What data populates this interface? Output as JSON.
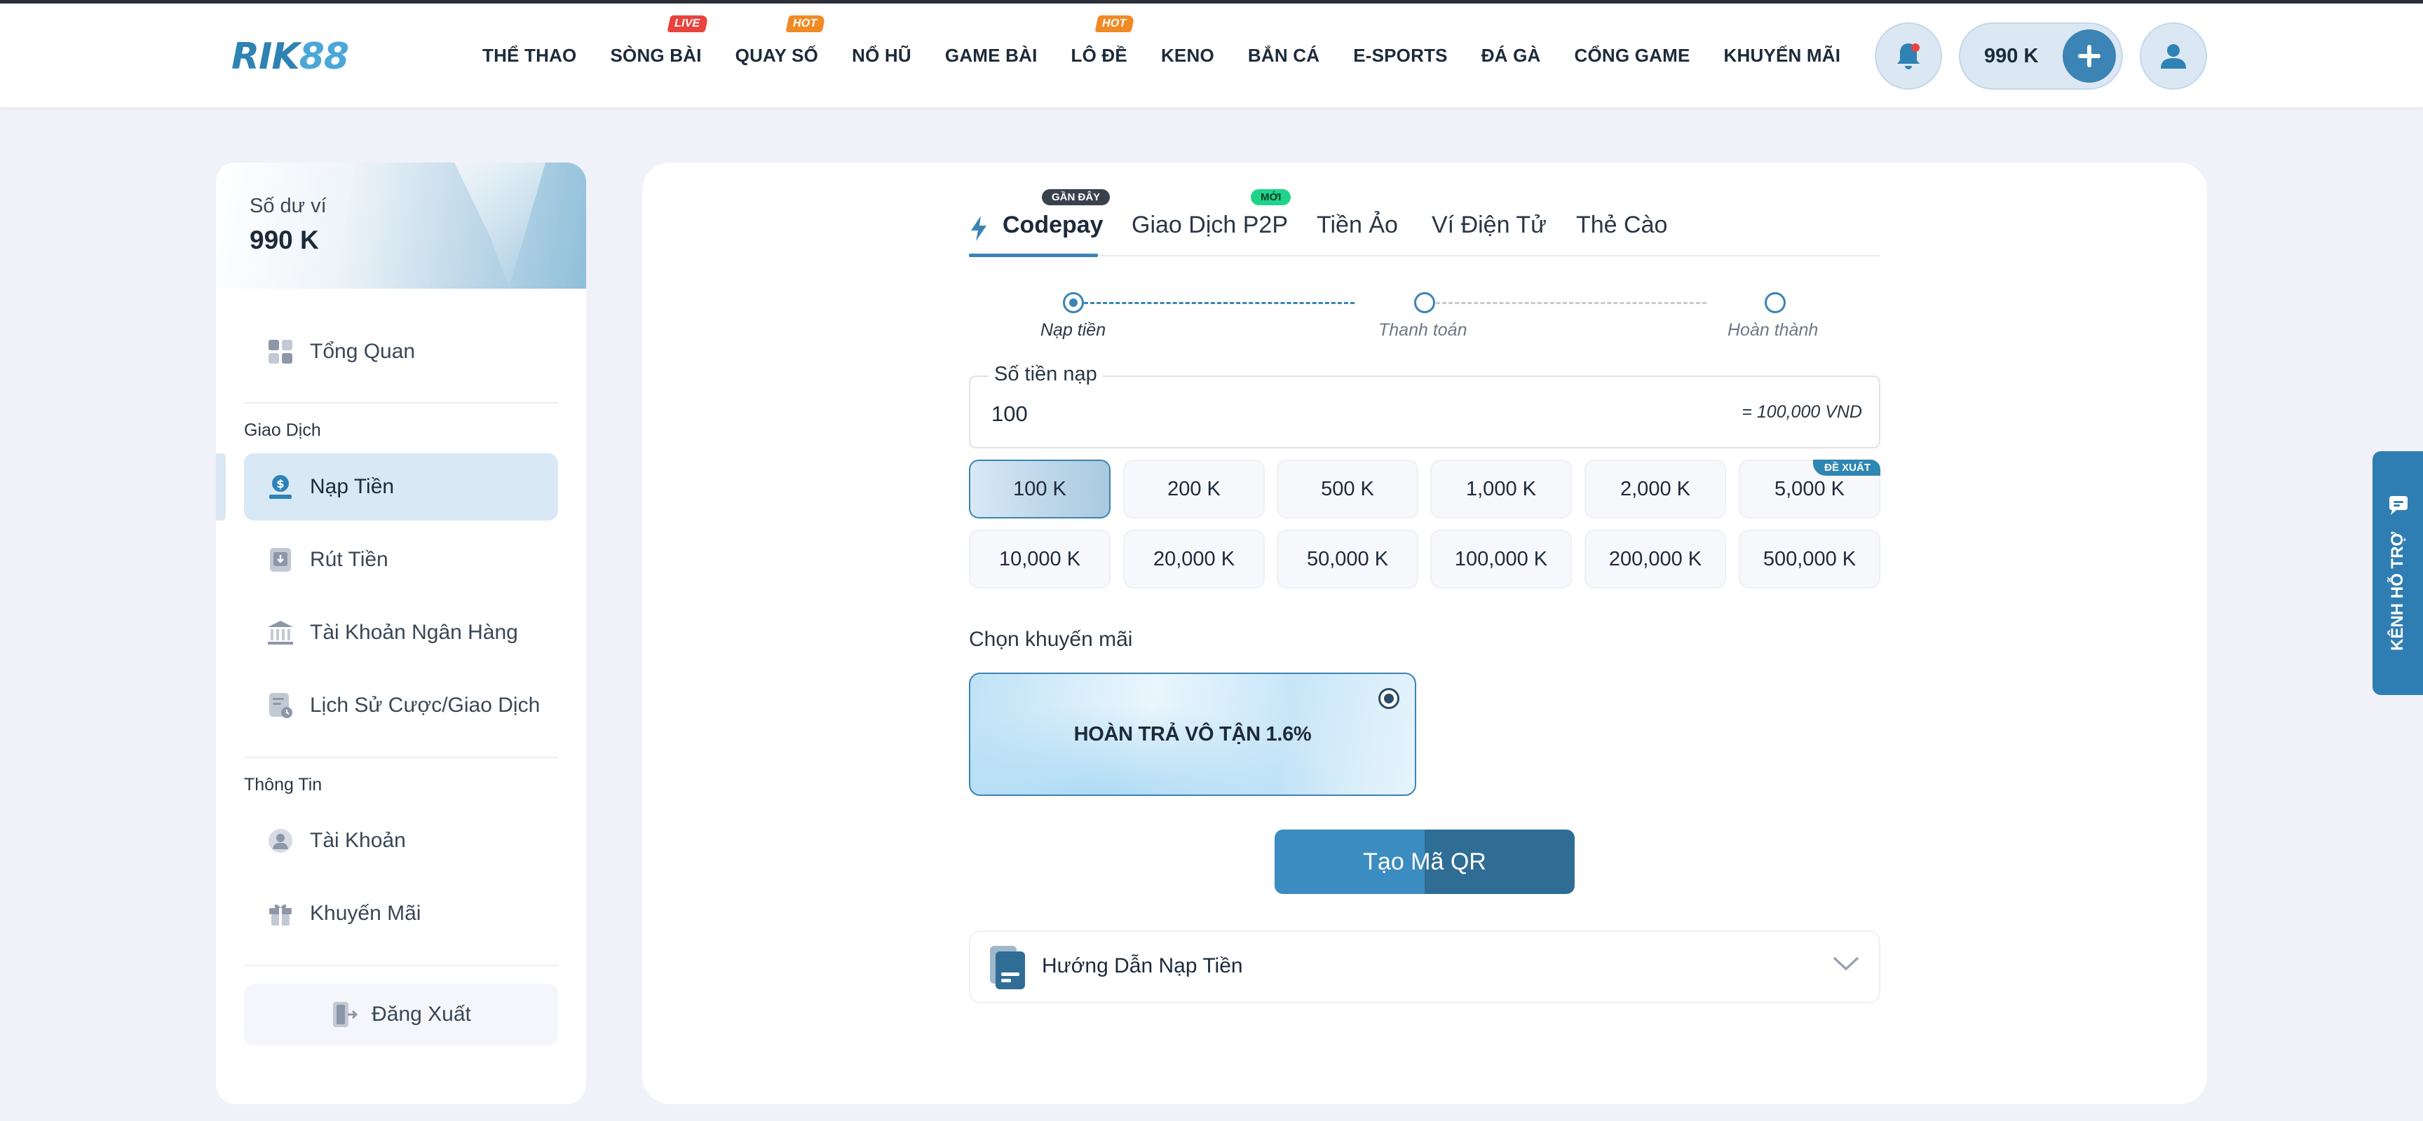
{
  "brand": {
    "logo_part1": "RIK",
    "logo_part2": "88"
  },
  "nav": [
    {
      "label": "THỂ THAO",
      "badge": null
    },
    {
      "label": "SÒNG BÀI",
      "badge": "LIVE"
    },
    {
      "label": "QUAY SỐ",
      "badge": "HOT"
    },
    {
      "label": "NỔ HŨ",
      "badge": null
    },
    {
      "label": "GAME BÀI",
      "badge": null
    },
    {
      "label": "LÔ ĐỀ",
      "badge": "HOT"
    },
    {
      "label": "KENO",
      "badge": null
    },
    {
      "label": "BẮN CÁ",
      "badge": null
    },
    {
      "label": "E-SPORTS",
      "badge": null
    },
    {
      "label": "ĐÁ GÀ",
      "badge": null
    },
    {
      "label": "CỔNG GAME",
      "badge": null
    },
    {
      "label": "KHUYẾN MÃI",
      "badge": null
    }
  ],
  "header": {
    "balance": "990 K",
    "bell_icon": "bell-icon",
    "user_icon": "user-icon",
    "plus_icon": "plus-icon"
  },
  "wallet": {
    "label": "Số dư ví",
    "value": "990 K"
  },
  "sidebar": {
    "overview": "Tổng Quan",
    "section_transactions": "Giao Dịch",
    "deposit": "Nạp Tiền",
    "withdraw": "Rút Tiền",
    "bank_account": "Tài Khoản Ngân Hàng",
    "history": "Lịch Sử Cược/Giao Dịch",
    "section_info": "Thông Tin",
    "account": "Tài Khoản",
    "promotions": "Khuyến Mãi",
    "logout": "Đăng Xuất"
  },
  "tabs": [
    {
      "label": "Codepay",
      "badge": "GẦN ĐÂY",
      "active": true
    },
    {
      "label": "Giao Dịch P2P",
      "badge": "MỚI",
      "active": false
    },
    {
      "label": "Tiền Ảo",
      "badge": null,
      "active": false
    },
    {
      "label": "Ví Điện Tử",
      "badge": null,
      "active": false
    },
    {
      "label": "Thẻ Cào",
      "badge": null,
      "active": false
    }
  ],
  "steps": [
    {
      "label": "Nạp tiền",
      "active": true
    },
    {
      "label": "Thanh toán",
      "active": false
    },
    {
      "label": "Hoàn thành",
      "active": false
    }
  ],
  "amount": {
    "label": "Số tiền nạp",
    "value": "100",
    "converted": "= 100,000 VND"
  },
  "amount_options": [
    {
      "label": "100 K",
      "selected": true,
      "badge": null
    },
    {
      "label": "200 K",
      "selected": false,
      "badge": null
    },
    {
      "label": "500 K",
      "selected": false,
      "badge": null
    },
    {
      "label": "1,000 K",
      "selected": false,
      "badge": null
    },
    {
      "label": "2,000 K",
      "selected": false,
      "badge": null
    },
    {
      "label": "5,000 K",
      "selected": false,
      "badge": "ĐỀ XUẤT"
    },
    {
      "label": "10,000 K",
      "selected": false,
      "badge": null
    },
    {
      "label": "20,000 K",
      "selected": false,
      "badge": null
    },
    {
      "label": "50,000 K",
      "selected": false,
      "badge": null
    },
    {
      "label": "100,000 K",
      "selected": false,
      "badge": null
    },
    {
      "label": "200,000 K",
      "selected": false,
      "badge": null
    },
    {
      "label": "500,000 K",
      "selected": false,
      "badge": null
    }
  ],
  "promo": {
    "label": "Chọn khuyến mãi",
    "option": "HOÀN TRẢ VÔ TẬN 1.6%",
    "selected": true
  },
  "submit": {
    "label": "Tạo Mã QR"
  },
  "guide": {
    "label": "Hướng Dẫn Nạp Tiền"
  },
  "support": {
    "label": "KÊNH HỖ TRỢ"
  },
  "colors": {
    "accent": "#3b84b5",
    "live": "#e8433d",
    "hot": "#f08a24",
    "new": "#20d38a"
  }
}
